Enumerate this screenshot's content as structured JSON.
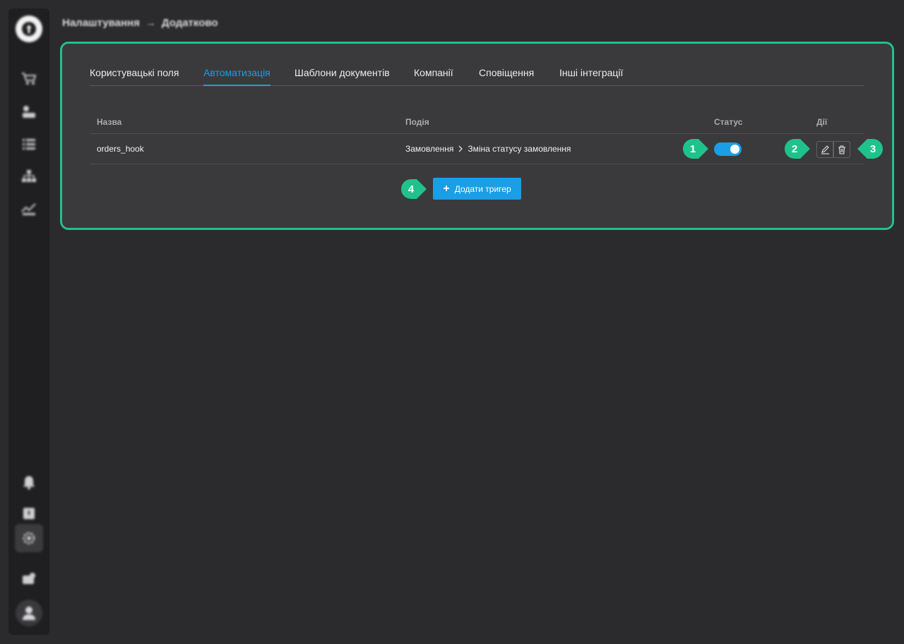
{
  "breadcrumb": {
    "items": [
      "Налаштування",
      "Додатково"
    ],
    "separator": "→"
  },
  "tabs": [
    {
      "label": "Користувацькі поля",
      "active": false
    },
    {
      "label": "Автоматизація",
      "active": true
    },
    {
      "label": "Шаблони документів",
      "active": false
    },
    {
      "label": "Компанії",
      "active": false
    },
    {
      "label": "Сповіщення",
      "active": false
    },
    {
      "label": "Інші інтеграції",
      "active": false
    }
  ],
  "table": {
    "columns": {
      "name": "Назва",
      "event": "Подія",
      "status": "Статус",
      "actions": "Дії"
    },
    "rows": [
      {
        "name": "orders_hook",
        "event_category": "Замовлення",
        "event_action": "Зміна статусу замовлення",
        "status_enabled": true
      }
    ]
  },
  "add_button": {
    "label": "Додати тригер"
  },
  "markers": [
    "1",
    "2",
    "3",
    "4"
  ],
  "sidebar": {
    "icons": [
      "cart-icon",
      "customers-icon",
      "tasks-list-icon",
      "structure-icon",
      "analytics-icon",
      "bell-icon",
      "help-icon",
      "settings-icon",
      "integrations-icon"
    ]
  },
  "colors": {
    "accent": "#1a9ee6",
    "marker": "#1fc28b",
    "background": "#2b2b2d",
    "panel": "#3a3a3c"
  }
}
